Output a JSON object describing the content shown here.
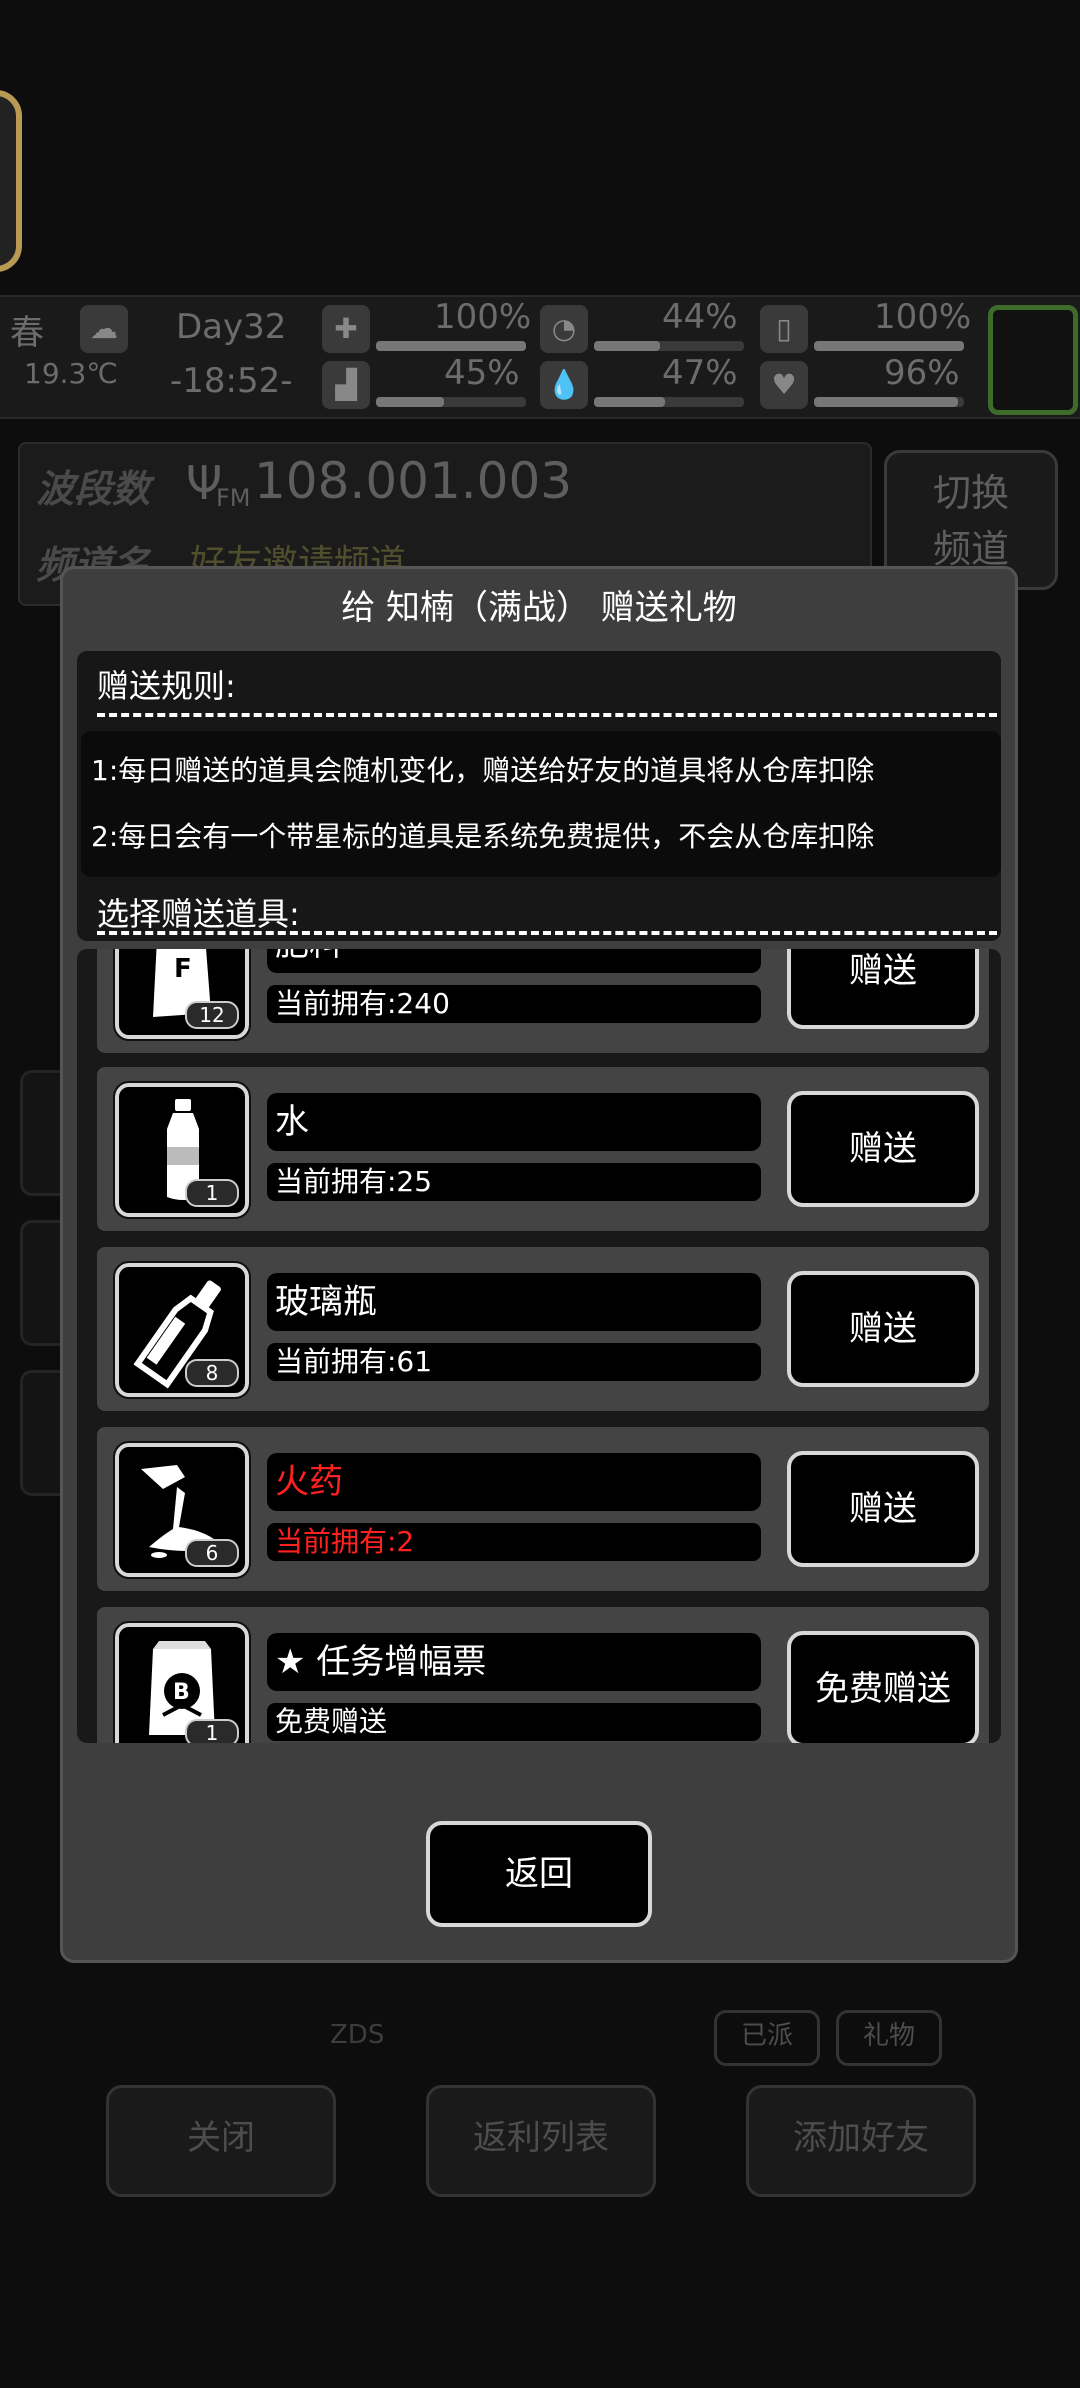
{
  "background": {
    "season": "春",
    "temperature": "19.3℃",
    "day": "Day32",
    "time": "-18:52-",
    "stats_top": [
      "100%",
      "44%",
      "100%"
    ],
    "stats_bottom": [
      "45%",
      "47%",
      "96%"
    ],
    "radio": {
      "band_label": "波段数",
      "channel_label": "频道名",
      "frequency": "108.001.003",
      "fm_label": "FM",
      "channel_name": "好友邀请频道",
      "switch_button": "切换\n频道"
    },
    "chat_hint": "ZDS",
    "chips": [
      "已派",
      "礼物"
    ],
    "bottom_buttons": [
      "关闭",
      "返利列表",
      "添加好友"
    ]
  },
  "modal": {
    "title": "给 知楠（满战） 赠送礼物",
    "rules_title": "赠送规则:",
    "rules": [
      "1:每日赠送的道具会随机变化，赠送给好友的道具将从仓库扣除",
      "2:每日会有一个带星标的道具是系统免费提供，不会从仓库扣除"
    ],
    "select_title": "选择赠送道具:",
    "items": [
      {
        "name": "肥料",
        "owned": "当前拥有:240",
        "count": "12",
        "button": "赠送",
        "icon": "fertilizer-bag-icon"
      },
      {
        "name": "水",
        "owned": "当前拥有:25",
        "count": "1",
        "button": "赠送",
        "icon": "water-bottle-icon"
      },
      {
        "name": "玻璃瓶",
        "owned": "当前拥有:61",
        "count": "8",
        "button": "赠送",
        "icon": "glass-bottle-icon"
      },
      {
        "name": "火药",
        "owned": "当前拥有:2",
        "count": "6",
        "button": "赠送",
        "icon": "gunpowder-icon",
        "highlight_color": "#ff2020"
      },
      {
        "name": "任务增幅票",
        "owned": "免费赠送",
        "count": "1",
        "button": "免费赠送",
        "icon": "ticket-bag-icon",
        "starred": true
      }
    ],
    "back_button": "返回"
  }
}
